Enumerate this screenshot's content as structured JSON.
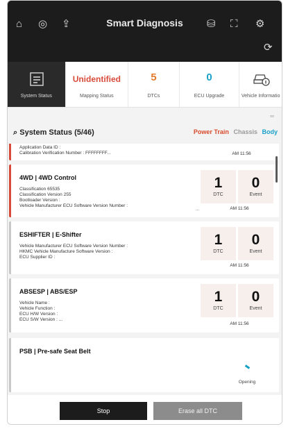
{
  "header": {
    "title": "Smart Diagnosis",
    "icons": [
      "home-icon",
      "globe-icon",
      "share-icon",
      "database-icon",
      "screen-icon",
      "settings-icon",
      "car-sync-icon"
    ]
  },
  "summary": {
    "system_status_label": "System Status",
    "mapping_value": "Unidentified",
    "mapping_label": "Mapping Status",
    "dtcs_value": "5",
    "dtcs_label": "DTCs",
    "ecu_value": "0",
    "ecu_label": "ECU Upgrade",
    "vehicle_label": "Vehicle Informatio"
  },
  "section": {
    "title": "System Status (5/46)",
    "tabs": [
      "Power Train",
      "Chassis",
      "Body"
    ]
  },
  "cards": [
    {
      "details": [
        "Application Data ID :",
        "Calibration Verification Number : FFFFFFFF..."
      ],
      "time": "AM 11:56"
    },
    {
      "name": "4WD | 4WD Control",
      "details": [
        "Classification 65535",
        "Classification Version 255",
        "Bootloader Version :",
        "Vehicle Manufacturer ECU Software Version Number :"
      ],
      "dtc_count": "1",
      "dtc_label": "DTC",
      "event_count": "0",
      "event_label": "Event",
      "time": "AM 11:56",
      "ellipsis": "..."
    },
    {
      "name": "ESHIFTER | E-Shifter",
      "details": [
        "Vehicle Manufacturer ECU Software Version Number :",
        "HKMC Vehicle Manufacture Software Version :",
        "ECU Supplier ID :"
      ],
      "dtc_count": "1",
      "dtc_label": "DTC",
      "event_count": "0",
      "event_label": "Event",
      "time": "AM 11:56"
    },
    {
      "name": "ABSESP | ABS/ESP",
      "details": [
        "Vehicle Name :",
        "Vehicle Function :",
        "ECU H/W Version :",
        "ECU S/W Version : ..."
      ],
      "dtc_count": "1",
      "dtc_label": "DTC",
      "event_count": "0",
      "event_label": "Event",
      "time": "AM 11:56"
    },
    {
      "name": "PSB | Pre-safe Seat Belt",
      "status": "Opening"
    }
  ],
  "buttons": {
    "stop": "Stop",
    "erase": "Erase all DTC"
  }
}
